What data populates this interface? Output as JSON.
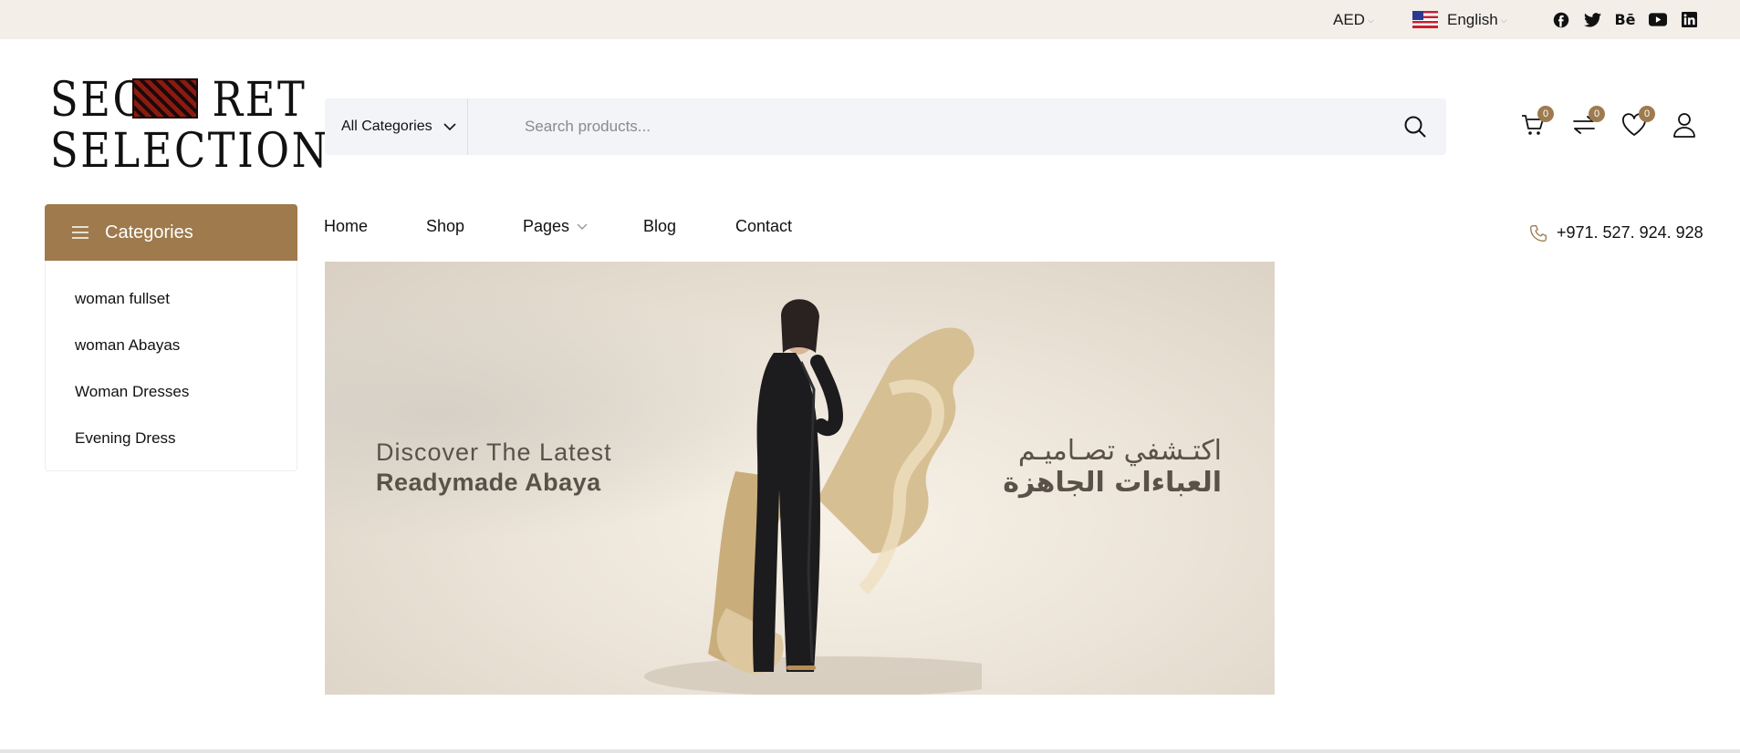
{
  "topbar": {
    "currency": "AED",
    "language": "English",
    "social": [
      "facebook-icon",
      "twitter-icon",
      "behance-icon",
      "youtube-icon",
      "linkedin-icon"
    ]
  },
  "logo": {
    "line1_a": "SEC",
    "line1_b": "RET",
    "line2": "SELECTION"
  },
  "search": {
    "category": "All Categories",
    "placeholder": "Search products..."
  },
  "header_icons": {
    "cart_count": "0",
    "compare_count": "0",
    "wishlist_count": "0"
  },
  "sidebar": {
    "title": "Categories",
    "items": [
      "woman fullset",
      "woman Abayas",
      "Woman Dresses",
      "Evening Dress"
    ]
  },
  "nav": {
    "items": [
      "Home",
      "Shop",
      "Pages",
      "Blog",
      "Contact"
    ],
    "phone": "+971. 527. 924. 928"
  },
  "banner": {
    "en_line1": "Discover The Latest",
    "en_line2": "Readymade Abaya",
    "ar_line1": "اكتـشفي تصـاميـم",
    "ar_line2": "العباءات الجاهزة"
  },
  "colors": {
    "accent": "#9e7a4c",
    "topbar_bg": "#f3eee8",
    "search_bg": "#f3f4f7"
  }
}
